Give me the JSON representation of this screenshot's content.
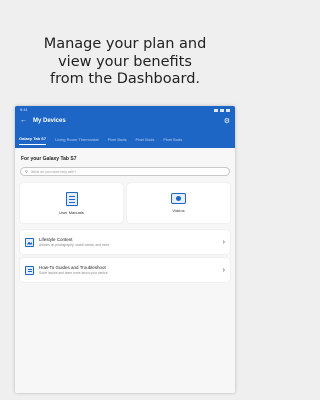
{
  "headline": {
    "line1": "Manage your plan and",
    "line2": "view your benefits",
    "line3": "from the Dashboard."
  },
  "statusbar": {
    "time": "9:41"
  },
  "appbar": {
    "title": "My Devices"
  },
  "tabs": [
    {
      "label": "Galaxy Tab S7"
    },
    {
      "label": "Living Room Thermostat"
    },
    {
      "label": "Pixel Buds"
    },
    {
      "label": "Pixel Buds"
    },
    {
      "label": "Pixel Buds"
    }
  ],
  "section": {
    "label": "For your Galaxy Tab S7"
  },
  "search": {
    "placeholder": "What do you need help with?"
  },
  "cards": [
    {
      "label": "User Manuals",
      "icon": "book-icon"
    },
    {
      "label": "Videos",
      "icon": "video-icon"
    }
  ],
  "list": [
    {
      "title": "Lifestyle Content",
      "subtitle": "Articles on photography, social media, and more",
      "icon": "image-icon"
    },
    {
      "title": "How-To Guides and Troubleshoot",
      "subtitle": "Solve issues and learn more about your device",
      "icon": "guide-icon"
    }
  ],
  "colors": {
    "brand": "#1e66c6"
  }
}
